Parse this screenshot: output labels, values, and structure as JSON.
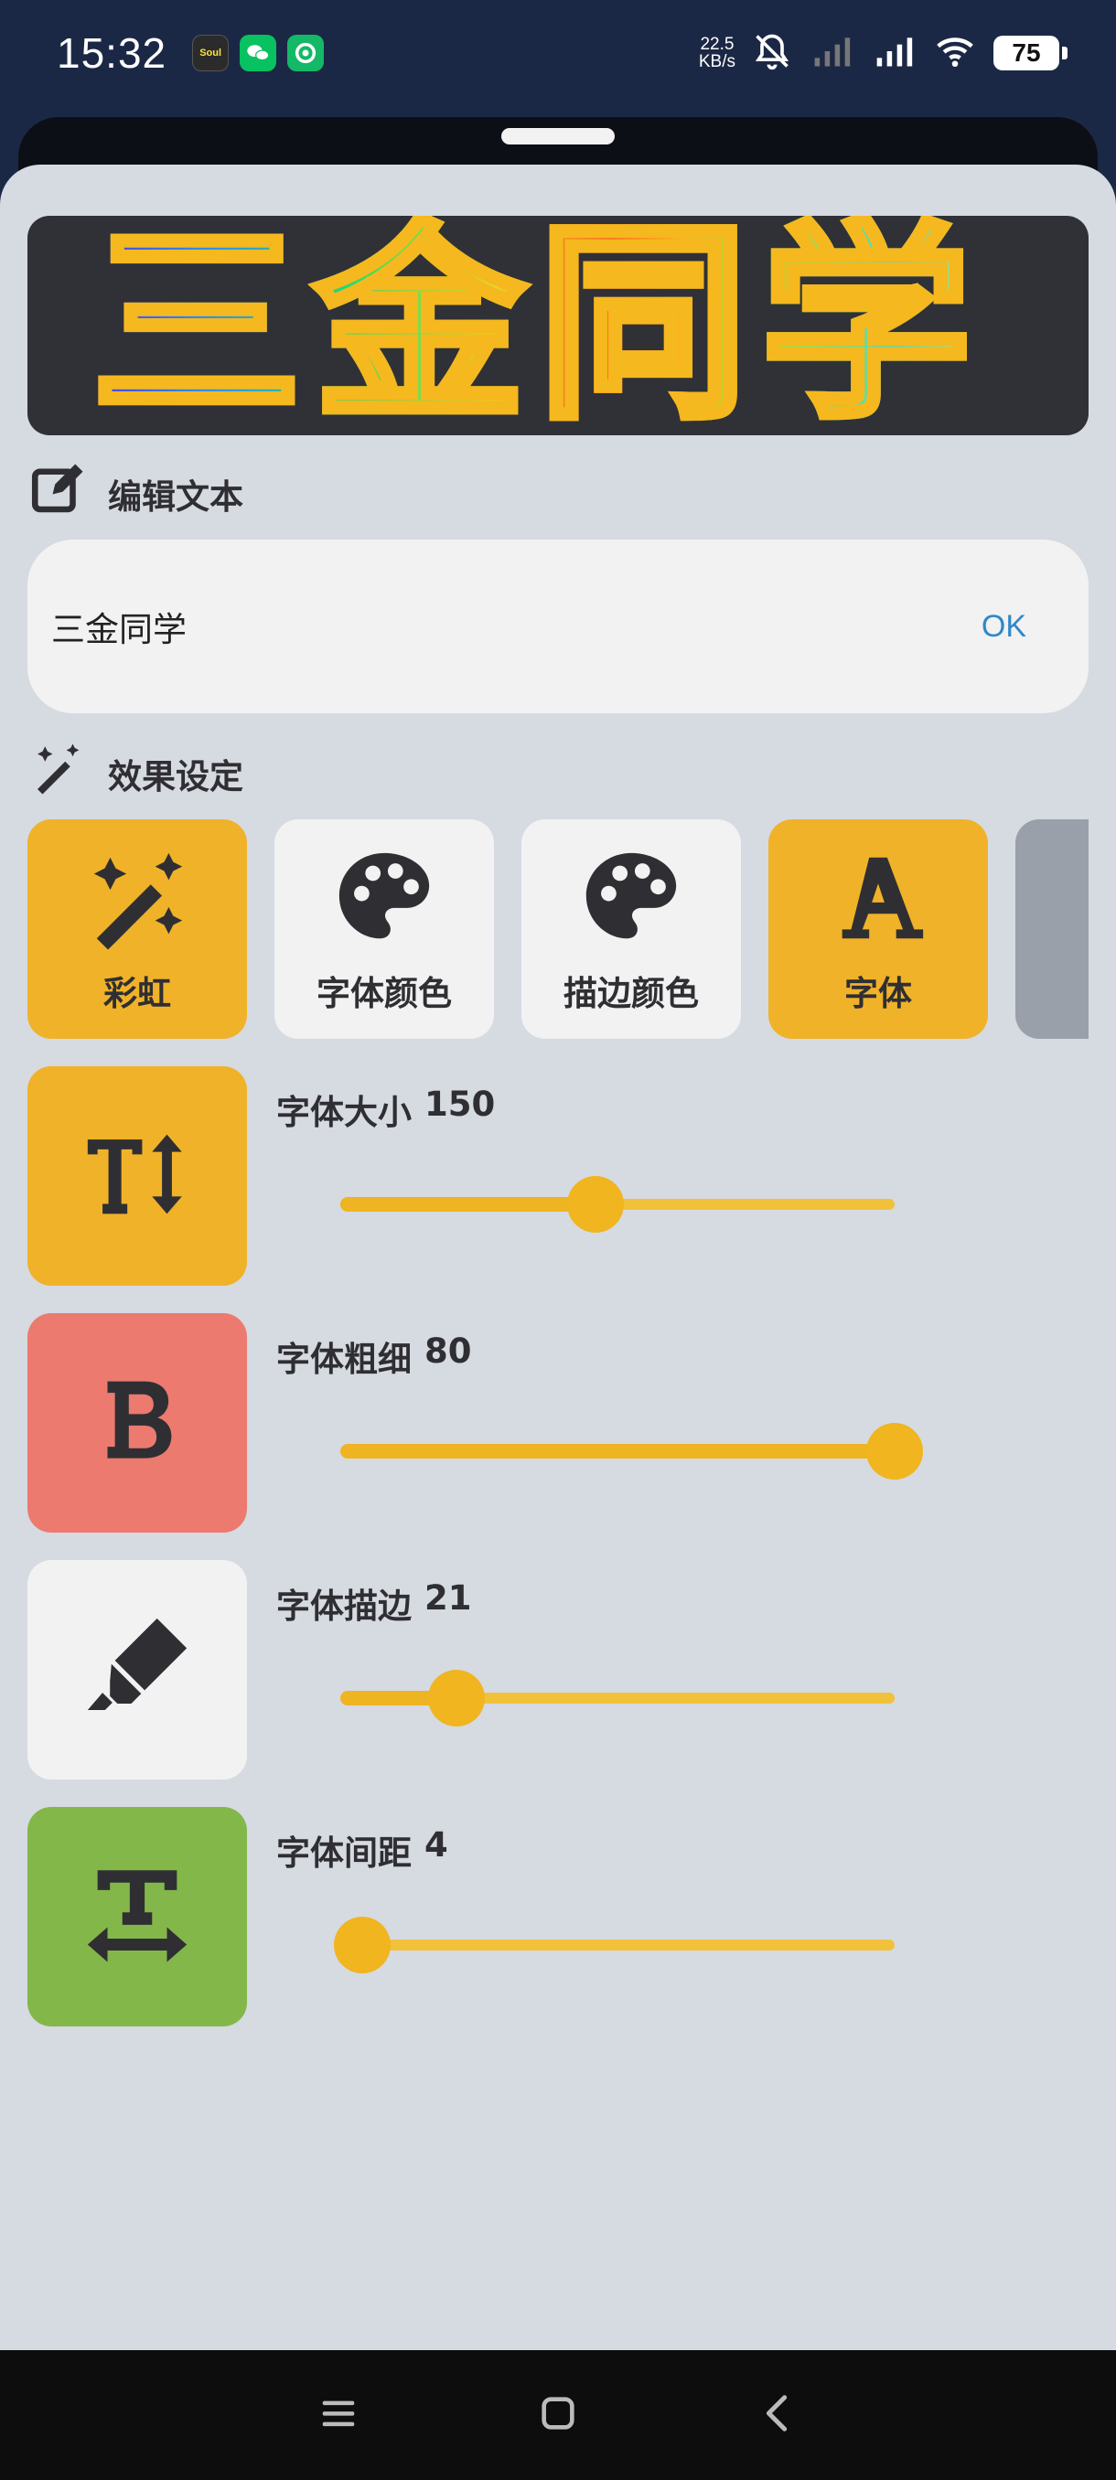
{
  "status_bar": {
    "time": "15:32",
    "apps": [
      "Soul",
      "WeChat",
      "Cloud"
    ],
    "network_speed_value": "22.5",
    "network_speed_unit": "KB/s",
    "battery": "75"
  },
  "banner": {
    "text": "三金同学"
  },
  "edit_section": {
    "title": "编辑文本"
  },
  "text_input": {
    "value": "三金同学",
    "ok_label": "OK"
  },
  "effects_section": {
    "title": "效果设定"
  },
  "effects": [
    {
      "label": "彩虹",
      "icon": "magic-wand-icon",
      "selected": true
    },
    {
      "label": "字体颜色",
      "icon": "palette-icon",
      "selected": false
    },
    {
      "label": "描边颜色",
      "icon": "palette-icon",
      "selected": false
    },
    {
      "label": "字体",
      "icon": "font-a-icon",
      "selected": true
    }
  ],
  "sliders": [
    {
      "label": "字体大小",
      "value": "150",
      "fraction": 0.46,
      "icon": "text-height-icon",
      "color": "#f0b229"
    },
    {
      "label": "字体粗细",
      "value": "80",
      "fraction": 1.0,
      "icon": "bold-icon",
      "color": "#ec7a6f"
    },
    {
      "label": "字体描边",
      "value": "21",
      "fraction": 0.21,
      "icon": "highlighter-icon",
      "color": "#f2f2f2"
    },
    {
      "label": "字体间距",
      "value": "4",
      "fraction": 0.04,
      "icon": "text-width-icon",
      "color": "#83b74a"
    }
  ],
  "colors": {
    "accent": "#f0b229",
    "ok_blue": "#2f88c9",
    "panel": "#d6dae1"
  }
}
